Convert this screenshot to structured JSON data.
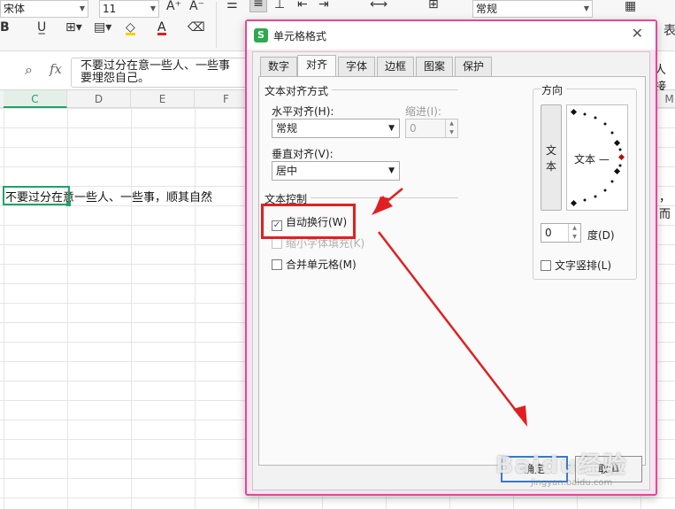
{
  "ribbon": {
    "font_name": "宋体",
    "font_size": "11",
    "number_format": "常规",
    "increase_font": "A⁺",
    "decrease_font": "A⁻",
    "bold": "B",
    "font_color_letter": "A",
    "right_edge_text": "表"
  },
  "formula_bar": {
    "fx": "fx",
    "content_line1": "不要过分在意一些人、一些事",
    "content_line2": "要埋怨自己。",
    "content_right": "人接"
  },
  "columns": [
    "C",
    "D",
    "E",
    "F",
    "M"
  ],
  "sheet": {
    "cell_text": "不要过分在意一些人、一些事，顺其自然",
    "cell_text_right": "，而"
  },
  "dialog": {
    "logo": "S",
    "title": "单元格格式",
    "close": "✕",
    "tabs": [
      "数字",
      "对齐",
      "字体",
      "边框",
      "图案",
      "保护"
    ],
    "active_tab": "对齐",
    "text_alignment_group": "文本对齐方式",
    "horizontal_label": "水平对齐(H):",
    "horizontal_value": "常规",
    "indent_label": "缩进(I):",
    "indent_value": "0",
    "vertical_label": "垂直对齐(V):",
    "vertical_value": "居中",
    "text_control_group": "文本控制",
    "wrap_text_label": "自动换行(W)",
    "wrap_text_checked": true,
    "shrink_to_fit_label": "缩小字体填充(K)",
    "merge_cells_label": "合并单元格(M)",
    "orientation_group": "方向",
    "vertical_text_button": "文本",
    "dial_text": "文本 —",
    "degrees_value": "0",
    "degrees_label": "度(D)",
    "vertical_arrange_label": "文字竖排(L)",
    "ok_button": "确定",
    "cancel_button": "取消"
  },
  "watermark": {
    "text": "Baidu经验",
    "sub": "jingyan.baidu.com"
  },
  "colors": {
    "dialog_border": "#e4479a",
    "highlight": "#e02020",
    "active_cell": "#21a366"
  }
}
